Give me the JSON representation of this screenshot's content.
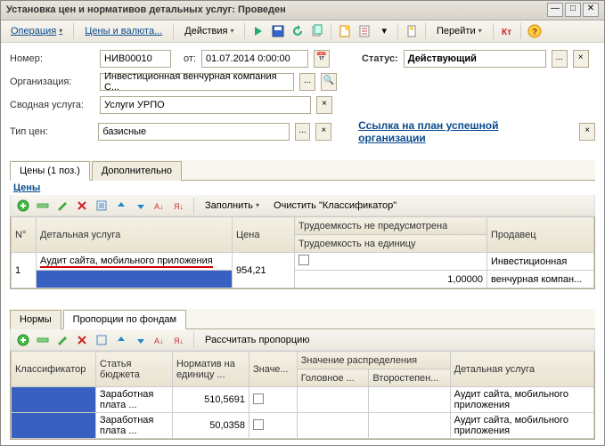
{
  "title": "Установка цен и нормативов детальных услуг: Проведен",
  "toolbar": {
    "operation": "Операция",
    "prices": "Цены и валюта...",
    "actions": "Действия",
    "goto": "Перейти"
  },
  "form": {
    "number_label": "Номер:",
    "number_value": "НИВ00010",
    "from_label": "от:",
    "date_value": "01.07.2014 0:00:00",
    "status_label": "Статус:",
    "status_value": "Действующий",
    "org_label": "Организация:",
    "org_value": "Инвестиционная венчурная компания С...",
    "service_label": "Сводная услуга:",
    "service_value": "Услуги УРПО",
    "type_label": "Тип цен:",
    "type_value": "базисные",
    "plan_link": "Ссылка на план успешной организации"
  },
  "tabs1": {
    "a": "Цены (1 поз.)",
    "b": "Дополнительно"
  },
  "prices_panel_title": "Цены",
  "prices_toolbar": {
    "fill": "Заполнить",
    "clear": "Очистить \"Классификатор\""
  },
  "grid1_headers": {
    "n": "N°",
    "service": "Детальная услуга",
    "price": "Цена",
    "labor_na": "Трудоемкость не предусмотрена",
    "labor_unit": "Трудоемкость на единицу",
    "seller": "Продавец"
  },
  "grid1_row": {
    "n": "1",
    "service": "Аудит сайта, мобильного приложения",
    "price": "954,21",
    "labor_unit": "1,00000",
    "seller1": "Инвестиционная",
    "seller2": "венчурная компан..."
  },
  "tabs2": {
    "a": "Нормы",
    "b": "Пропорции по фондам"
  },
  "prop_toolbar": {
    "calc": "Рассчитать пропорцию"
  },
  "grid2_headers": {
    "class": "Классификатор",
    "budget": "Статья бюджета",
    "norm": "Норматив на единицу ...",
    "value": "Значе...",
    "dist": "Значение распределения",
    "main": "Головное ...",
    "second": "Второстепен...",
    "detail": "Детальная услуга"
  },
  "grid2_rows": [
    {
      "budget": "Заработная плата ...",
      "norm": "510,5691",
      "detail": "Аудит сайта, мобильного приложения"
    },
    {
      "budget": "Заработная плата ...",
      "norm": "50,0358",
      "detail": "Аудит сайта, мобильного приложения"
    }
  ]
}
